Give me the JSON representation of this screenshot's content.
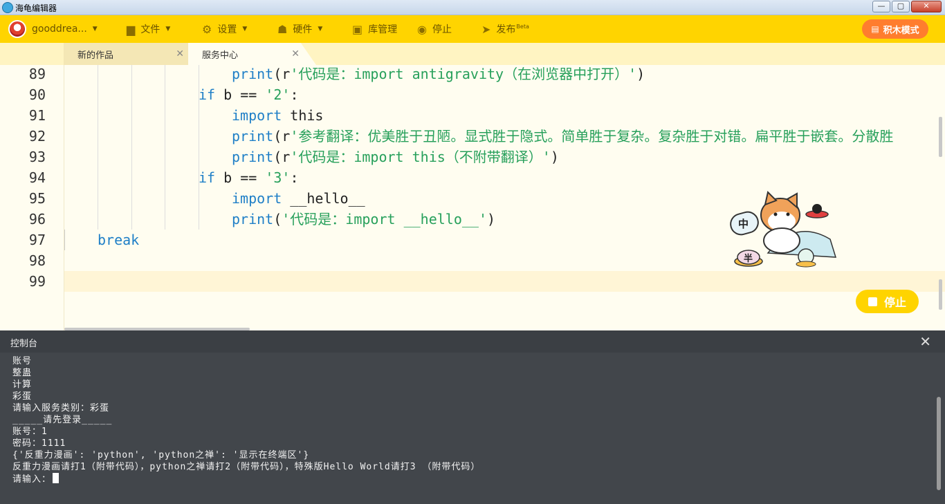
{
  "window": {
    "title": "海龟编辑器"
  },
  "toolbar": {
    "user": "gooddrea...",
    "file": "文件",
    "settings": "设置",
    "hardware": "硬件",
    "library": "库管理",
    "stop": "停止",
    "publish": "发布",
    "publish_badge": "Beta",
    "mode": "积木模式"
  },
  "tabs": [
    {
      "label": "新的作品",
      "active": false
    },
    {
      "label": "服务中心",
      "active": true
    }
  ],
  "editor": {
    "line_numbers": [
      "89",
      "90",
      "91",
      "92",
      "93",
      "94",
      "95",
      "96",
      "97",
      "98",
      "99"
    ],
    "current_line": "99",
    "lines": {
      "l89_fn": "print",
      "l89_a": "(r",
      "l89_str": "'代码是：import antigravity（在浏览器中打开）'",
      "l89_b": ")",
      "l90_kw": "if",
      "l90_a": " b == ",
      "l90_str": "'2'",
      "l90_b": ":",
      "l91_kw": "import",
      "l91_a": " this",
      "l92_fn": "print",
      "l92_a": "(r",
      "l92_str": "'参考翻译：优美胜于丑陋。显式胜于隐式。简单胜于复杂。复杂胜于对错。扁平胜于嵌套。分散胜",
      "l93_fn": "print",
      "l93_a": "(r",
      "l93_str": "'代码是：import this（不附带翻译）'",
      "l93_b": ")",
      "l94_kw": "if",
      "l94_a": " b == ",
      "l94_str": "'3'",
      "l94_b": ":",
      "l95_kw": "import",
      "l95_a": " __hello__",
      "l96_fn": "print",
      "l96_a": "(",
      "l96_str": "'代码是：import __hello__'",
      "l96_b": ")",
      "l97_kw": "break"
    },
    "stop_button": "停止"
  },
  "mascot": {
    "bubble": "中",
    "bowl": "半"
  },
  "console": {
    "title": "控制台",
    "lines": [
      "账号",
      "整蛊",
      "计算",
      "彩蛋",
      "请输入服务类别：彩蛋",
      "_____请先登录_____",
      "账号：1",
      "密码：1111",
      "{'反重力漫画': 'python', 'python之禅': '显示在终端区'}",
      "反重力漫画请打1（附带代码），python之禅请打2（附带代码），特殊版Hello World请打3 （附带代码）",
      "请输入："
    ]
  },
  "colors": {
    "toolbar": "#ffd400",
    "keyword": "#1f7fc7",
    "string": "#27a05b",
    "mode_button": "#ff7d2e",
    "console_bg": "#42464b"
  },
  "icons": [
    "folder-icon",
    "gear-icon",
    "hardware-icon",
    "library-icon",
    "stop-icon",
    "send-icon",
    "blocks-icon",
    "close-icon"
  ]
}
